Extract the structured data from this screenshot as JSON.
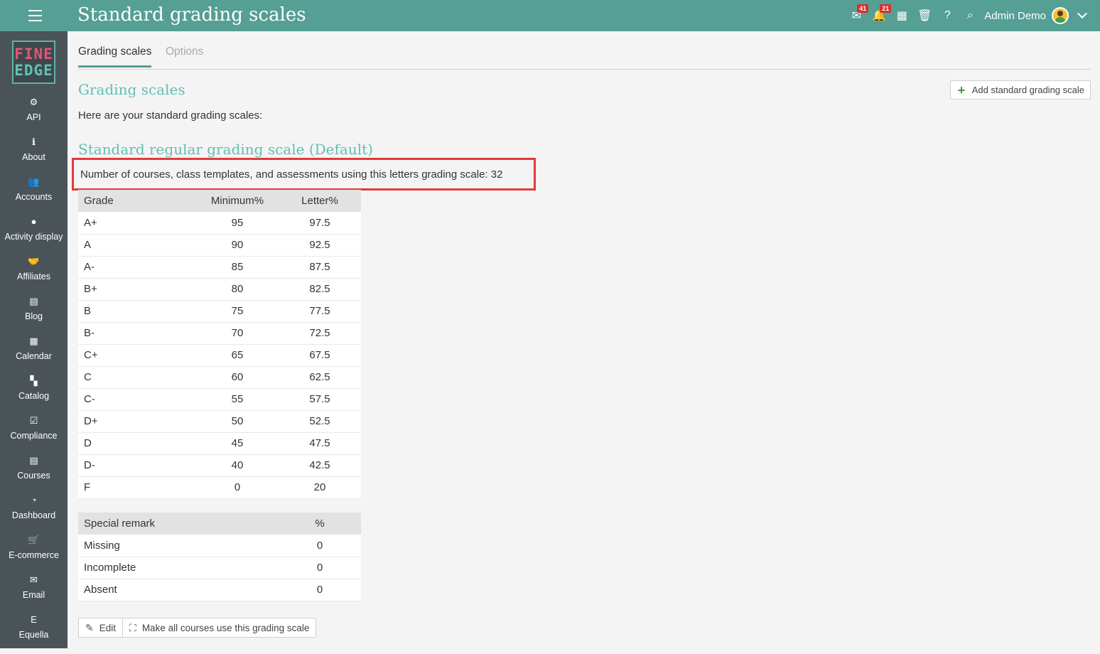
{
  "header": {
    "title": "Standard grading scales",
    "mail_badge": "41",
    "notifications_badge": "21",
    "user_name": "Admin Demo"
  },
  "logo": {
    "line1": "FINE",
    "line2": "EDGE"
  },
  "sidebar": {
    "items": [
      {
        "label": "API",
        "icon": "gear-icon",
        "glyph": "⚙"
      },
      {
        "label": "About",
        "icon": "info-icon",
        "glyph": "ℹ"
      },
      {
        "label": "Accounts",
        "icon": "users-icon",
        "glyph": "👥"
      },
      {
        "label": "Activity display",
        "icon": "dot-icon",
        "glyph": "●"
      },
      {
        "label": "Affiliates",
        "icon": "handshake-icon",
        "glyph": "🤝"
      },
      {
        "label": "Blog",
        "icon": "blog-icon",
        "glyph": "▤"
      },
      {
        "label": "Calendar",
        "icon": "calendar-icon",
        "glyph": "▦"
      },
      {
        "label": "Catalog",
        "icon": "grid-icon",
        "glyph": "▚"
      },
      {
        "label": "Compliance",
        "icon": "checklist-icon",
        "glyph": "☑"
      },
      {
        "label": "Courses",
        "icon": "courses-icon",
        "glyph": "▤"
      },
      {
        "label": "Dashboard",
        "icon": "gauge-icon",
        "glyph": "◔"
      },
      {
        "label": "E-commerce",
        "icon": "cart-icon",
        "glyph": "🛒"
      },
      {
        "label": "Email",
        "icon": "envelope-icon",
        "glyph": "✉"
      },
      {
        "label": "Equella",
        "icon": "equella-icon",
        "glyph": "E"
      }
    ]
  },
  "tabs": {
    "active": "Grading scales",
    "inactive": "Options"
  },
  "main": {
    "section_title": "Grading scales",
    "add_button": "Add standard grading scale",
    "intro": "Here are your standard grading scales:",
    "scale_title": "Standard regular grading scale (Default)",
    "usage_text": "Number of courses, class templates, and assessments using this letters grading scale: 32"
  },
  "grade_table": {
    "headers": [
      "Grade",
      "Minimum%",
      "Letter%"
    ],
    "rows": [
      [
        "A+",
        "95",
        "97.5"
      ],
      [
        "A",
        "90",
        "92.5"
      ],
      [
        "A-",
        "85",
        "87.5"
      ],
      [
        "B+",
        "80",
        "82.5"
      ],
      [
        "B",
        "75",
        "77.5"
      ],
      [
        "B-",
        "70",
        "72.5"
      ],
      [
        "C+",
        "65",
        "67.5"
      ],
      [
        "C",
        "60",
        "62.5"
      ],
      [
        "C-",
        "55",
        "57.5"
      ],
      [
        "D+",
        "50",
        "52.5"
      ],
      [
        "D",
        "45",
        "47.5"
      ],
      [
        "D-",
        "40",
        "42.5"
      ],
      [
        "F",
        "0",
        "20"
      ]
    ]
  },
  "remark_table": {
    "headers": [
      "Special remark",
      "%"
    ],
    "rows": [
      [
        "Missing",
        "0"
      ],
      [
        "Incomplete",
        "0"
      ],
      [
        "Absent",
        "0"
      ]
    ]
  },
  "actions": {
    "edit": "Edit",
    "make_all": "Make all courses use this grading scale"
  },
  "colors": {
    "topbar": "#559f94",
    "sidebar": "#4a5458",
    "accent": "#5fbfb3",
    "highlight_border": "#e5393b"
  }
}
